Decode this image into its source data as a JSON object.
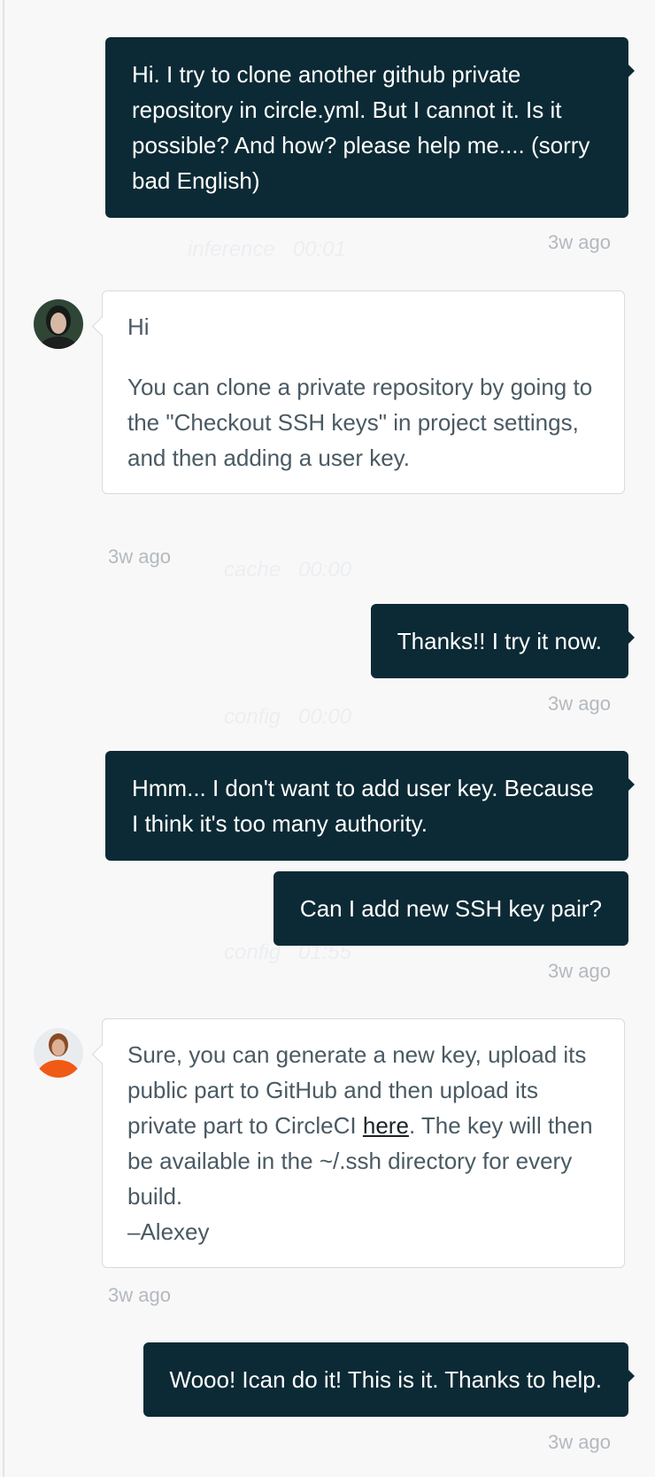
{
  "messages": [
    {
      "from": "me",
      "text": "Hi. I try to clone another github private repository in circle.yml. But I cannot it. Is it possible? And how? please help me.... (sorry bad English)",
      "time": "3w ago"
    },
    {
      "from": "support",
      "avatar": "avatar-dark-hair",
      "greeting": "Hi",
      "text": "You can clone a private repository by going to the \"Checkout SSH keys\" in project settings, and then adding a user key.",
      "time": "3w ago"
    },
    {
      "from": "me",
      "text": "Thanks!! I try it now.",
      "time": "3w ago"
    },
    {
      "from": "me",
      "text": "Hmm... I don't want to add user key. Because I think it's too many authority."
    },
    {
      "from": "me",
      "text": "Can I add new SSH key pair?",
      "time": "3w ago"
    },
    {
      "from": "support",
      "avatar": "avatar-orange-jacket",
      "text_before_link": "Sure, you can generate a new key, upload its public part to GitHub and then upload its private part to CircleCI",
      "link_text": "here",
      "text_after_link": ". The key will then be available in the ~/.ssh directory for every build.",
      "signature": "–Alexey",
      "time": "3w ago"
    },
    {
      "from": "me",
      "text": "Wooo! Ican do it! This is it. Thanks to help.",
      "time": "3w ago"
    }
  ],
  "background_steps": [
    {
      "name": "inference",
      "duration": "00:01"
    },
    {
      "name": "cache",
      "duration": "00:00"
    },
    {
      "name": "config",
      "duration": "00:00"
    },
    {
      "name": "config",
      "duration": "01:55"
    }
  ],
  "colors": {
    "outgoing_bubble": "#0c2a35",
    "incoming_bubble": "#ffffff",
    "incoming_text": "#4a5a63",
    "timestamp": "#b4b9bd",
    "page_background": "#f8f8f9"
  }
}
